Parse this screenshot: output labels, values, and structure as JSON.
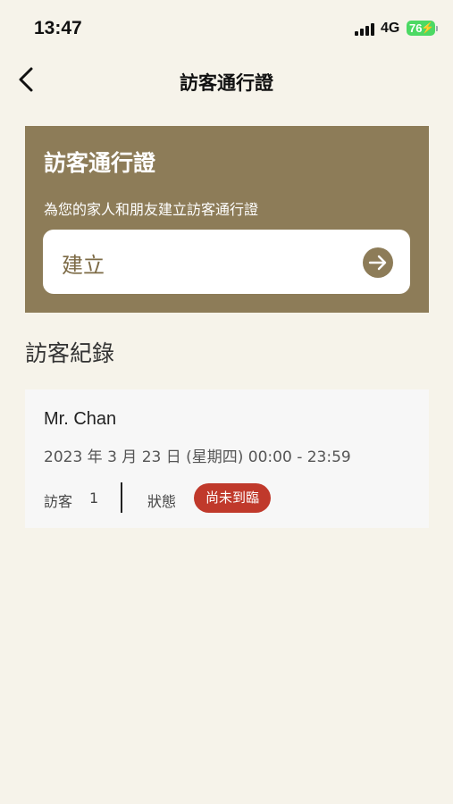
{
  "status_bar": {
    "time": "13:47",
    "network": "4G",
    "battery": "76"
  },
  "nav": {
    "title": "訪客通行證",
    "back_icon": "chevron-left-icon"
  },
  "hero": {
    "title": "訪客通行證",
    "subtitle": "為您的家人和朋友建立訪客通行證",
    "create_label": "建立",
    "create_icon": "arrow-right-circle-icon"
  },
  "records_section": {
    "title": "訪客紀錄",
    "records": [
      {
        "name": "Mr. Chan",
        "date": "2023 年 3 月 23 日 (星期四) 00:00 - 23:59",
        "visitor_label": "訪客",
        "visitor_count": "1",
        "status_label": "狀態",
        "status": "尚未到臨"
      }
    ]
  },
  "colors": {
    "background": "#f6f3ea",
    "brand": "#8d7c58",
    "brand_text": "#7d6b46",
    "status_badge": "#c0392b",
    "battery": "#4cd964"
  }
}
